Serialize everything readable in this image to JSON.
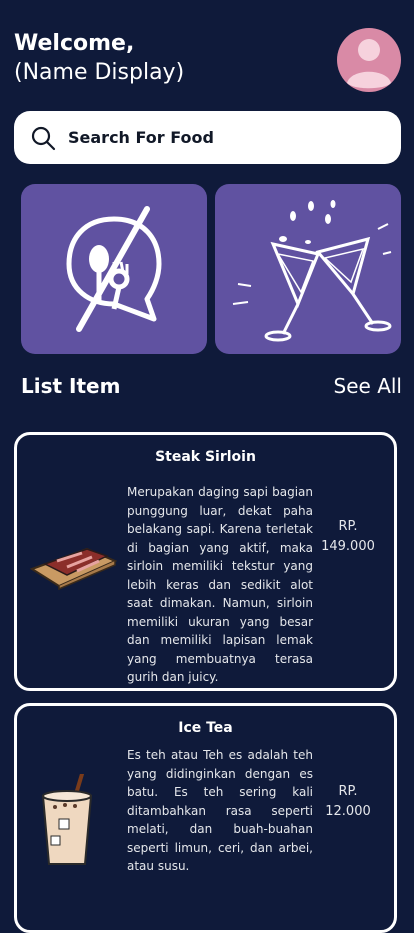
{
  "header": {
    "welcome": "Welcome,",
    "name_display": "(Name Display)"
  },
  "search": {
    "placeholder": "Search For Food"
  },
  "categories": [
    {
      "icon": "no-food-icon"
    },
    {
      "icon": "cheers-icon"
    }
  ],
  "list": {
    "title": "List Item",
    "see_all": "See All",
    "items": [
      {
        "title": "Steak Sirloin",
        "description": "Merupakan daging sapi bagian punggung luar, dekat paha belakang sapi. Karena terletak di bagian yang aktif, maka sirloin memiliki tekstur yang lebih keras dan sedikit alot saat dimakan. Namun, sirloin memiliki ukuran yang besar dan memiliki lapisan lemak yang membuatnya terasa gurih dan juicy.",
        "price_label": "RP.",
        "price_value": "149.000",
        "image_icon": "steak-icon"
      },
      {
        "title": "Ice Tea",
        "description": "Es teh atau Teh es adalah teh yang didinginkan dengan es batu. Es teh sering kali ditambahkan rasa seperti melati, dan buah-buahan seperti limun, ceri, dan arbei, atau susu.",
        "price_label": "RP.",
        "price_value": "12.000",
        "image_icon": "ice-tea-icon"
      }
    ]
  },
  "colors": {
    "background": "#0f1a3a",
    "tile": "#6052a1",
    "avatar": "#d98aa6"
  }
}
